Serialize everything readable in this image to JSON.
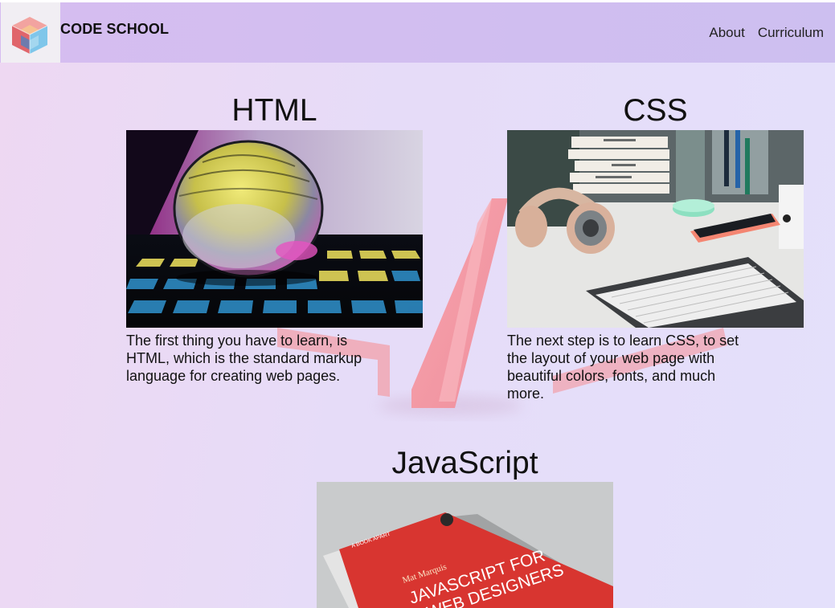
{
  "brand": {
    "name": "CODE SCHOOL",
    "logo_icon": "cube-logo-icon"
  },
  "nav": {
    "items": [
      {
        "label": "About"
      },
      {
        "label": "Curriculum"
      }
    ]
  },
  "sections": [
    {
      "title": "HTML",
      "image_icon": "crystal-ball-photo",
      "description": "The first thing you have to learn, is HTML, which is the standard markup language for creating web pages."
    },
    {
      "title": "CSS",
      "image_icon": "desk-headphones-photo",
      "description": "The next step is to learn CSS, to set the layout of your web page with beautiful colors, fonts, and much more."
    },
    {
      "title": "JavaScript",
      "image_icon": "javascript-book-photo",
      "description": ""
    }
  ],
  "book": {
    "author": "Mat Marquis",
    "title_line1": "JAVASCRIPT FOR",
    "title_line2": "WEB DESIGNERS",
    "badge": "A BOOK APART"
  },
  "colors": {
    "navbar": "#d0bef0",
    "accent_pink": "#f49aa6",
    "background": "#e8dbf7"
  }
}
